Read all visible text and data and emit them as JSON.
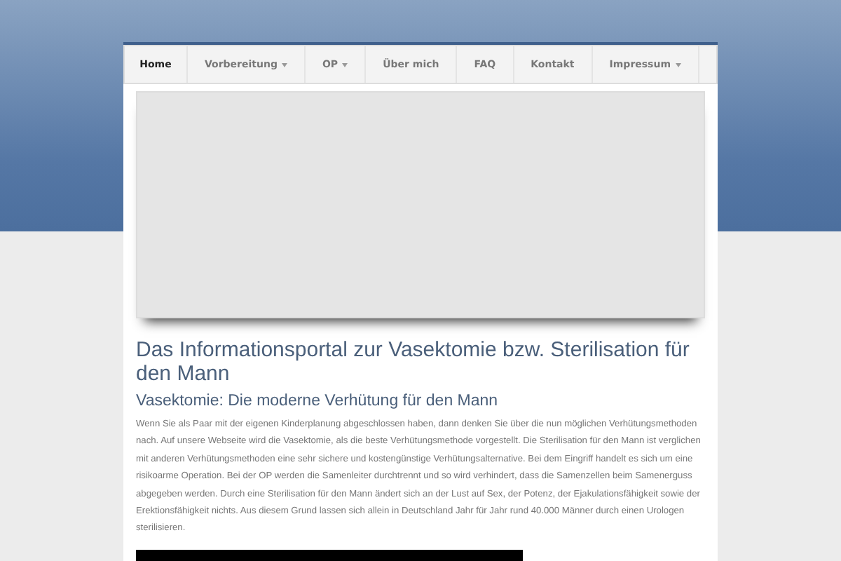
{
  "nav": {
    "items": [
      {
        "label": "Home",
        "selected": true,
        "has_submenu": false
      },
      {
        "label": "Vorbereitung",
        "selected": false,
        "has_submenu": true
      },
      {
        "label": "OP",
        "selected": false,
        "has_submenu": true
      },
      {
        "label": "Über mich",
        "selected": false,
        "has_submenu": false
      },
      {
        "label": "FAQ",
        "selected": false,
        "has_submenu": false
      },
      {
        "label": "Kontakt",
        "selected": false,
        "has_submenu": false
      },
      {
        "label": "Impressum",
        "selected": false,
        "has_submenu": true
      }
    ]
  },
  "slider": {
    "kind": "placeholder"
  },
  "title": "Das Informationsportal zur Vasektomie bzw. Sterilisation für den Mann",
  "subtitle": "Vasektomie: Die moderne Verhütung für den Mann",
  "paragraph": "Wenn Sie als Paar mit der eigenen Kinderplanung abgeschlossen haben, dann denken Sie über die nun möglichen Verhütungsmethoden nach. Auf unsere Webseite  wird die Vasektomie, als die beste Verhütungsmethode vorgestellt. Die Sterilisation für den Mann ist verglichen mit anderen Verhütungsmethoden eine sehr sichere und kostengünstige Verhütungsalternative. Bei dem Eingriff  handelt es sich um eine risikoarme Operation. Bei der OP werden die Samenleiter durchtrennt und so wird verhindert, dass die Samenzellen beim Samenerguss abgegeben werden. Durch eine Sterilisation für den Mann ändert sich an der Lust auf Sex, der Potenz, der Ejakulationsfähigkeit sowie der Erektionsfähigkeit nichts. Aus diesem Grund lassen sich allein in Deutschland Jahr für Jahr rund 40.000 Männer durch einen Urologen sterilisieren.",
  "video": {
    "kind": "video"
  }
}
